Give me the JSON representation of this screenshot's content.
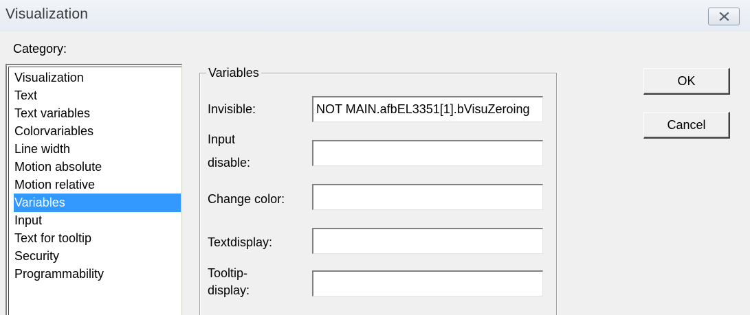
{
  "window": {
    "title": "Visualization",
    "close_icon": "close-icon"
  },
  "category": {
    "label": "Category:",
    "items": [
      {
        "label": "Visualization",
        "selected": false
      },
      {
        "label": "Text",
        "selected": false
      },
      {
        "label": "Text variables",
        "selected": false
      },
      {
        "label": "Colorvariables",
        "selected": false
      },
      {
        "label": "Line width",
        "selected": false
      },
      {
        "label": "Motion absolute",
        "selected": false
      },
      {
        "label": "Motion relative",
        "selected": false
      },
      {
        "label": "Variables",
        "selected": true
      },
      {
        "label": "Input",
        "selected": false
      },
      {
        "label": "Text for tooltip",
        "selected": false
      },
      {
        "label": "Security",
        "selected": false
      },
      {
        "label": "Programmability",
        "selected": false
      }
    ],
    "selection_color": "#3399ff"
  },
  "variables_group": {
    "title": "Variables",
    "fields": {
      "invisible": {
        "label": "Invisible:",
        "value": "NOT MAIN.afbEL3351[1].bVisuZeroing"
      },
      "input_disable": {
        "label_line1": "Input",
        "label_line2": "disable:",
        "value": ""
      },
      "change_color": {
        "label": "Change color:",
        "value": ""
      },
      "textdisplay": {
        "label": "Textdisplay:",
        "value": ""
      },
      "tooltip_display": {
        "label_line1": "Tooltip-",
        "label_line2": "display:",
        "value": ""
      }
    }
  },
  "buttons": {
    "ok": "OK",
    "cancel": "Cancel"
  }
}
